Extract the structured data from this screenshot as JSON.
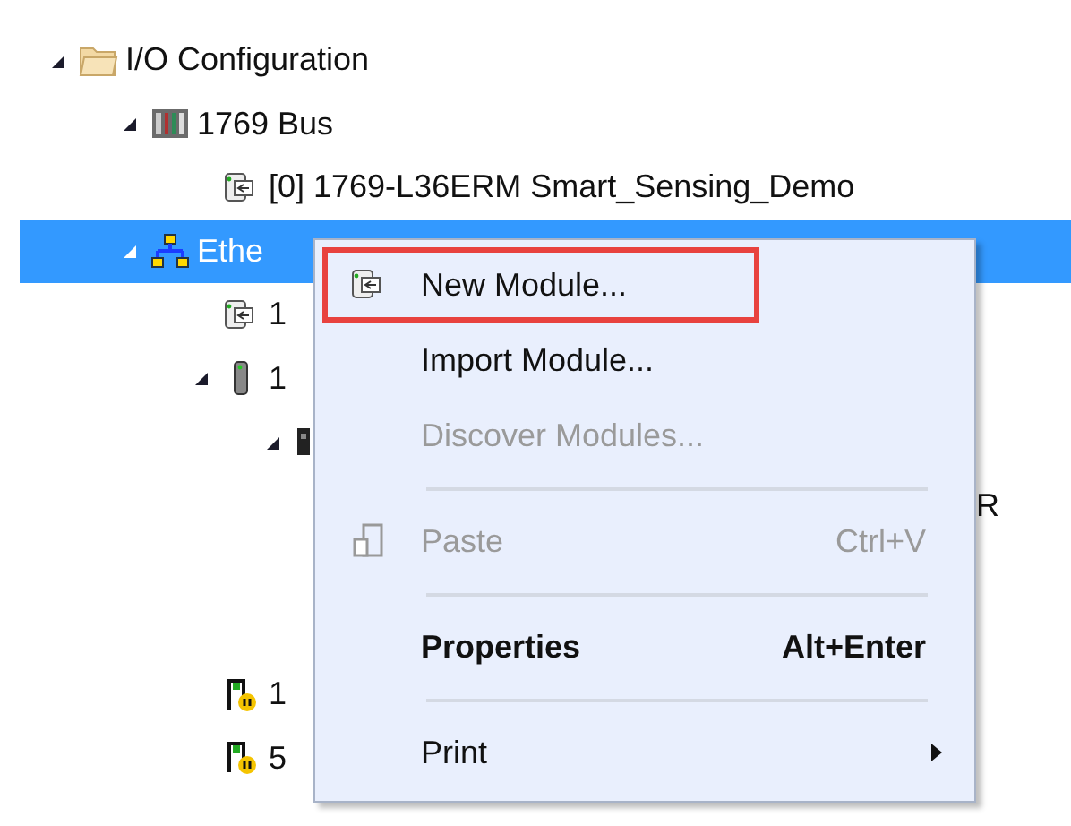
{
  "tree": [
    {
      "label": "I/O Configuration",
      "kind": "folder",
      "expanded": true,
      "selected": false,
      "children": [
        {
          "label": "1769 Bus",
          "kind": "rack",
          "expanded": true,
          "selected": false,
          "children": [
            {
              "label": "[0] 1769-L36ERM Smart_Sensing_Demo",
              "kind": "module",
              "selected": false
            }
          ]
        },
        {
          "label": "Ethe",
          "kind": "network",
          "expanded": true,
          "selected": true,
          "children": [
            {
              "label": "1",
              "kind": "module",
              "selected": false
            },
            {
              "label": "1",
              "kind": "drive",
              "expanded": true,
              "selected": false,
              "children": [
                {
                  "kind": "device",
                  "expanded": true,
                  "selected": false,
                  "children": [
                    {
                      "label": "R",
                      "kind": "tail",
                      "selected": false
                    }
                  ]
                }
              ]
            },
            {
              "label": "1",
              "kind": "warning-device",
              "selected": false
            },
            {
              "label": "5",
              "kind": "warning-device",
              "selected": false
            }
          ]
        }
      ]
    }
  ],
  "menu": [
    {
      "kind": "module",
      "label": "New Module...",
      "highlighted": true,
      "disabled": false,
      "bold": false
    },
    {
      "kind": "plain",
      "label": "Import Module...",
      "highlighted": false,
      "disabled": false,
      "bold": false
    },
    {
      "kind": "plain",
      "label": "Discover Modules...",
      "highlighted": false,
      "disabled": true,
      "bold": false
    },
    {
      "kind": "separator"
    },
    {
      "kind": "paste",
      "label": "Paste",
      "shortcut": "Ctrl+V",
      "highlighted": false,
      "disabled": true,
      "bold": false
    },
    {
      "kind": "separator"
    },
    {
      "kind": "plain",
      "label": "Properties",
      "shortcut": "Alt+Enter",
      "highlighted": false,
      "disabled": false,
      "bold": true
    },
    {
      "kind": "separator"
    },
    {
      "kind": "submenu",
      "label": "Print",
      "highlighted": false,
      "disabled": false,
      "bold": false
    }
  ]
}
